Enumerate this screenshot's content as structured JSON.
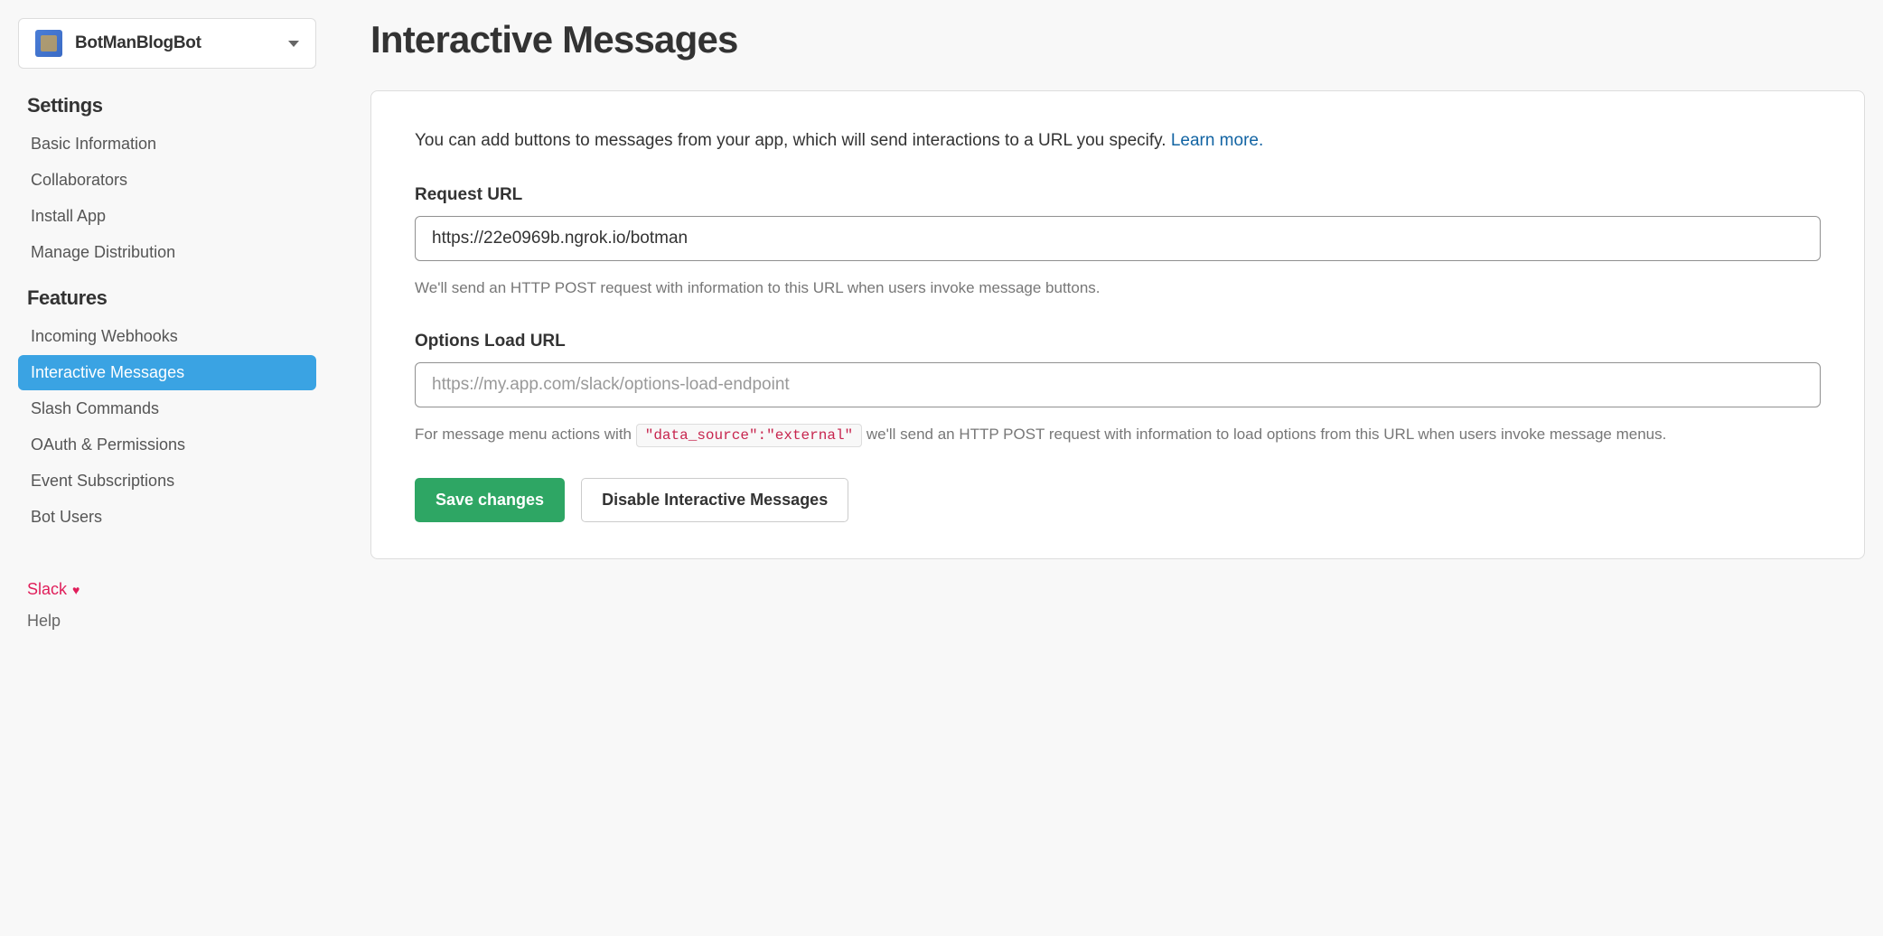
{
  "app_selector": {
    "name": "BotManBlogBot"
  },
  "sidebar": {
    "settings_header": "Settings",
    "features_header": "Features",
    "settings": [
      {
        "id": "basic-information",
        "label": "Basic Information"
      },
      {
        "id": "collaborators",
        "label": "Collaborators"
      },
      {
        "id": "install-app",
        "label": "Install App"
      },
      {
        "id": "manage-distribution",
        "label": "Manage Distribution"
      }
    ],
    "features": [
      {
        "id": "incoming-webhooks",
        "label": "Incoming Webhooks"
      },
      {
        "id": "interactive-messages",
        "label": "Interactive Messages",
        "active": true
      },
      {
        "id": "slash-commands",
        "label": "Slash Commands"
      },
      {
        "id": "oauth-permissions",
        "label": "OAuth & Permissions"
      },
      {
        "id": "event-subscriptions",
        "label": "Event Subscriptions"
      },
      {
        "id": "bot-users",
        "label": "Bot Users"
      }
    ],
    "footer": {
      "slack": "Slack",
      "help": "Help"
    }
  },
  "main": {
    "title": "Interactive Messages",
    "intro_text": "You can add buttons to messages from your app, which will send interactions to a URL you specify. ",
    "learn_more": "Learn more.",
    "request_url": {
      "label": "Request URL",
      "value": "https://22e0969b.ngrok.io/botman",
      "help": "We'll send an HTTP POST request with information to this URL when users invoke message buttons."
    },
    "options_url": {
      "label": "Options Load URL",
      "placeholder": "https://my.app.com/slack/options-load-endpoint",
      "value": "",
      "help_prefix": "For message menu actions with ",
      "help_code": "\"data_source\":\"external\"",
      "help_suffix": " we'll send an HTTP POST request with information to load options from this URL when users invoke message menus."
    },
    "buttons": {
      "save": "Save changes",
      "disable": "Disable Interactive Messages"
    }
  }
}
